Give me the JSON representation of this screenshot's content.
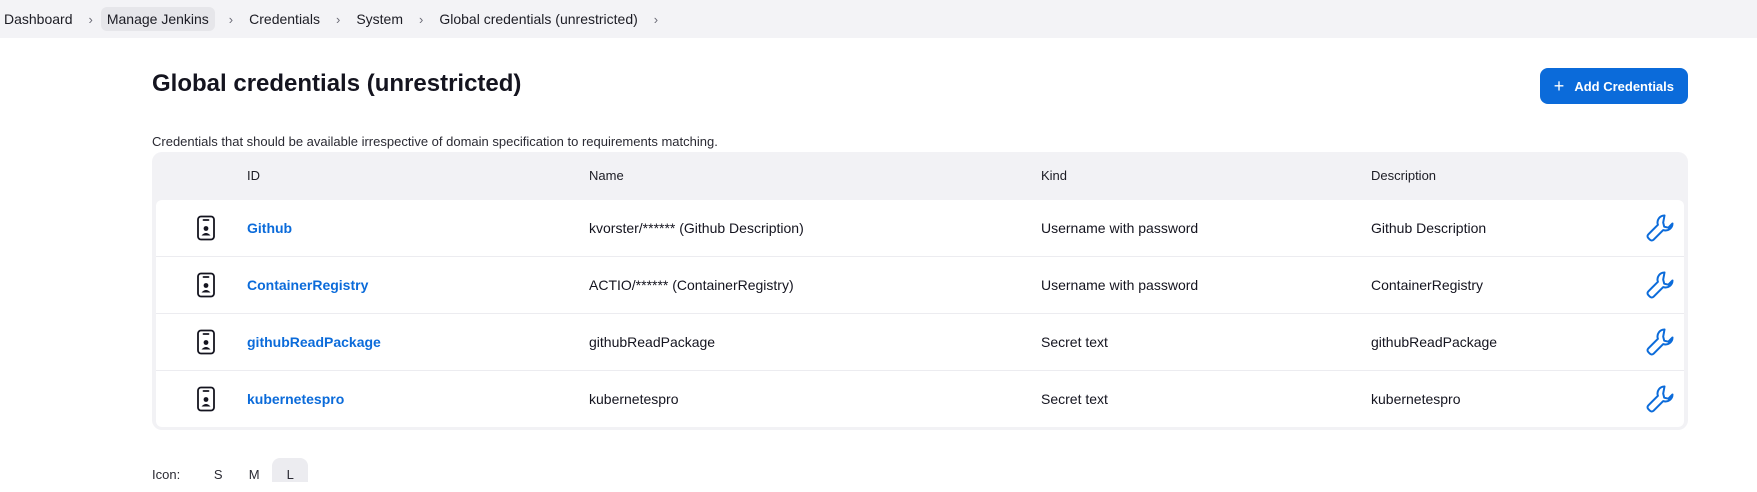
{
  "breadcrumb": {
    "items": [
      {
        "label": "Dashboard"
      },
      {
        "label": "Manage Jenkins"
      },
      {
        "label": "Credentials"
      },
      {
        "label": "System"
      },
      {
        "label": "Global credentials (unrestricted)"
      }
    ],
    "separator_icon": "chevron-right-icon"
  },
  "page": {
    "title": "Global credentials (unrestricted)",
    "add_button_label": "Add Credentials",
    "add_button_icon": "plus-icon",
    "description": "Credentials that should be available irrespective of domain specification to requirements matching."
  },
  "table": {
    "headers": {
      "id": "ID",
      "name": "Name",
      "kind": "Kind",
      "description": "Description"
    },
    "rows": [
      {
        "id": "Github",
        "name": "kvorster/****** (Github Description)",
        "kind": "Username with password",
        "description": "Github Description"
      },
      {
        "id": "ContainerRegistry",
        "name": "ACTIO/****** (ContainerRegistry)",
        "kind": "Username with password",
        "description": "ContainerRegistry"
      },
      {
        "id": "githubReadPackage",
        "name": "githubReadPackage",
        "kind": "Secret text",
        "description": "githubReadPackage"
      },
      {
        "id": "kubernetespro",
        "name": "kubernetespro",
        "kind": "Secret text",
        "description": "kubernetespro"
      }
    ],
    "row_icon": "credential-badge-icon",
    "action_icon": "wrench-icon"
  },
  "icon_size": {
    "label": "Icon:",
    "options": [
      "S",
      "M",
      "L"
    ],
    "selected": "L"
  },
  "colors": {
    "accent": "#0b6bda",
    "breadcrumb_bg": "#f3f3f6",
    "table_bg": "#f2f2f5"
  }
}
